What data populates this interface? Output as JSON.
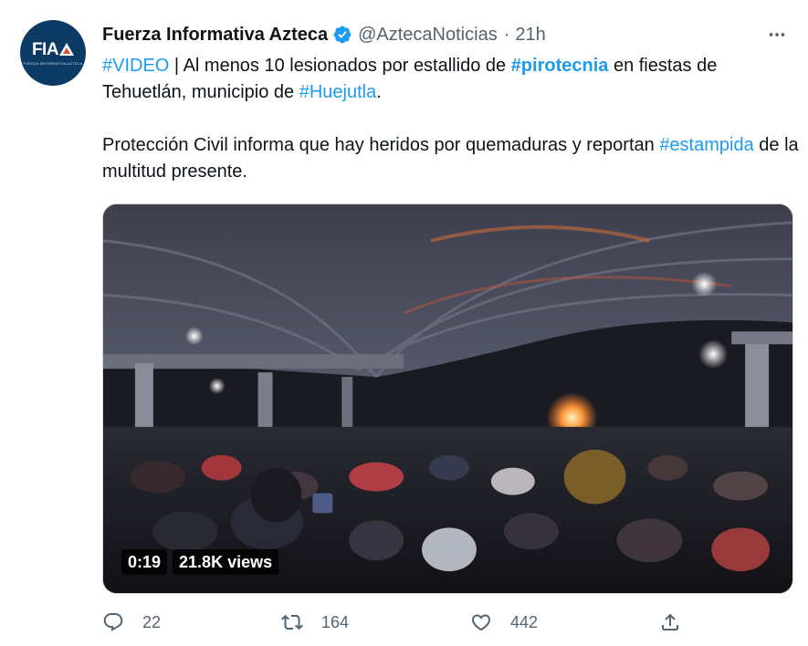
{
  "author": {
    "display_name": "Fuerza Informativa Azteca",
    "handle": "@AztecaNoticias",
    "separator": "·",
    "time": "21h",
    "avatar_text": "FIA",
    "avatar_subtext": "FUERZA INFORMATIVA AZTECA"
  },
  "tweet": {
    "line1": {
      "tag_video": "#VIDEO",
      "text_a": " | Al menos 10 lesionados por estallido de ",
      "tag_pirotecnia": "#pirotecnia",
      "text_b": " en fiestas de Tehuetlán, municipio de ",
      "tag_huejutla": "#Huejutla",
      "text_c": "."
    },
    "line2": {
      "text_a": "Protección Civil informa que hay heridos por quemaduras y reportan ",
      "tag_estampida": "#estampida",
      "text_b": " de la multitud presente."
    }
  },
  "media": {
    "duration": "0:19",
    "views": "21.8K views"
  },
  "actions": {
    "replies": "22",
    "retweets": "164",
    "likes": "442"
  },
  "colors": {
    "link": "#1d9bf0",
    "muted": "#536471",
    "verified": "#1d9bf0"
  }
}
